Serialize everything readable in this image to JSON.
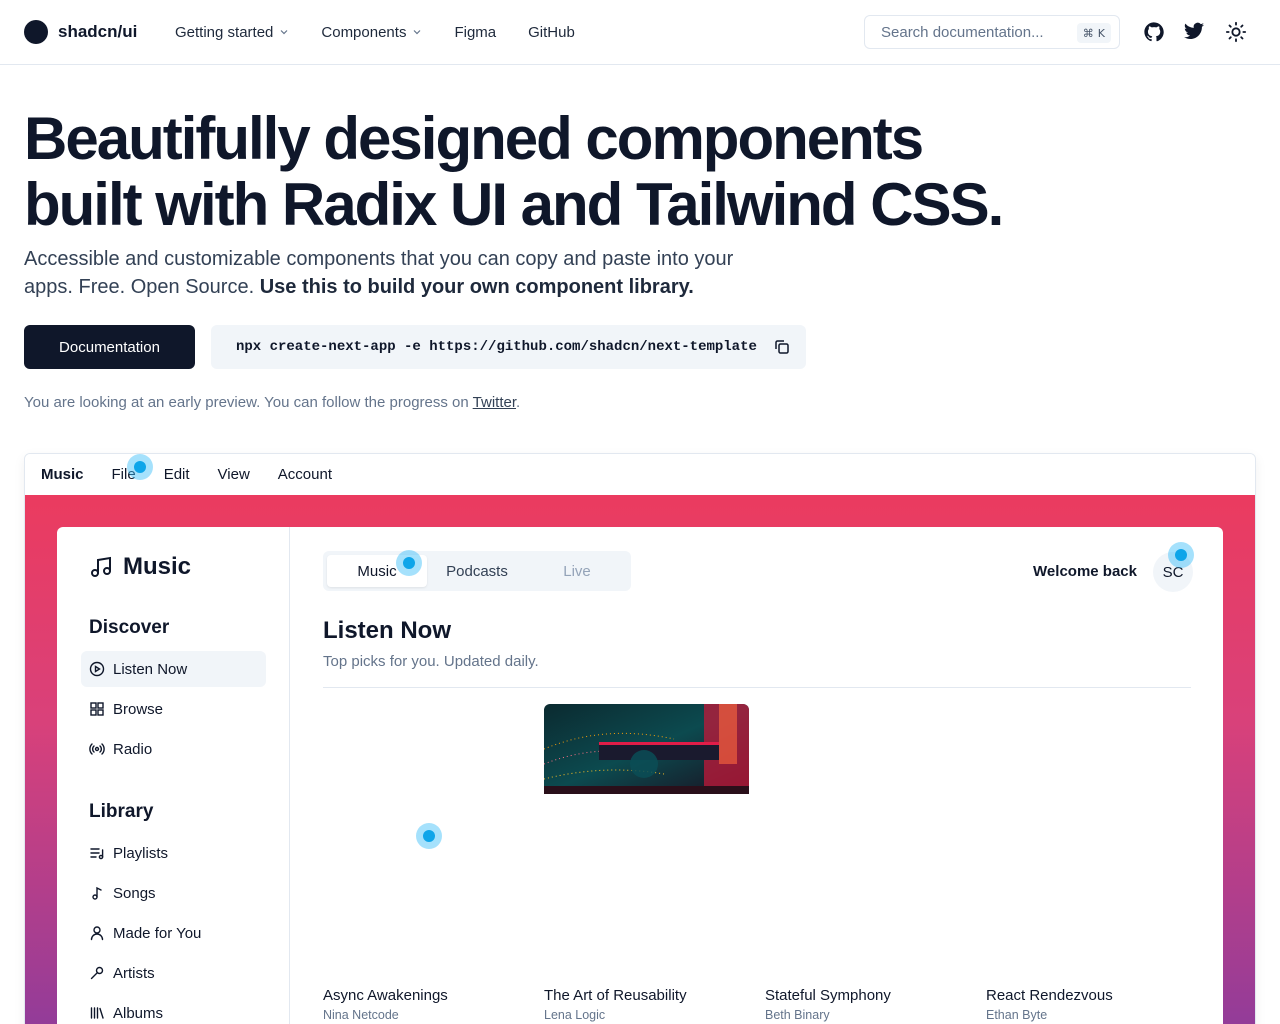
{
  "header": {
    "brand": "shadcn/ui",
    "nav": [
      {
        "label": "Getting started",
        "dropdown": true
      },
      {
        "label": "Components",
        "dropdown": true
      },
      {
        "label": "Figma",
        "dropdown": false
      },
      {
        "label": "GitHub",
        "dropdown": false
      }
    ],
    "search_placeholder": "Search documentation...",
    "search_shortcut_symbol": "⌘",
    "search_shortcut_key": "K",
    "icons": [
      "github-icon",
      "twitter-icon",
      "sun-icon"
    ]
  },
  "hero": {
    "title_line1": "Beautifully designed components",
    "title_line2": "built with Radix UI and Tailwind CSS.",
    "subtitle": "Accessible and customizable components that you can copy and paste into your apps. Free. Open Source.",
    "subtitle_bold": "Use this to build your own component library.",
    "doc_button": "Documentation",
    "command": "npx create-next-app -e https://github.com/shadcn/next-template",
    "note_prefix": "You are looking at an early preview. You can follow the progress on",
    "note_link": "Twitter",
    "note_suffix": "."
  },
  "demo": {
    "menubar": [
      "Music",
      "File",
      "Edit",
      "View",
      "Account"
    ],
    "app_title": "Music",
    "sections": {
      "discover": {
        "title": "Discover",
        "items": [
          {
            "label": "Listen Now",
            "icon": "play-circle-icon",
            "active": true
          },
          {
            "label": "Browse",
            "icon": "grid-icon",
            "active": false
          },
          {
            "label": "Radio",
            "icon": "radio-icon",
            "active": false
          }
        ]
      },
      "library": {
        "title": "Library",
        "items": [
          {
            "label": "Playlists",
            "icon": "playlist-icon"
          },
          {
            "label": "Songs",
            "icon": "music-note-icon"
          },
          {
            "label": "Made for You",
            "icon": "user-icon"
          },
          {
            "label": "Artists",
            "icon": "microphone-icon"
          },
          {
            "label": "Albums",
            "icon": "library-icon"
          }
        ]
      }
    },
    "tabs": [
      {
        "label": "Music",
        "state": "active"
      },
      {
        "label": "Podcasts",
        "state": "normal"
      },
      {
        "label": "Live",
        "state": "disabled"
      }
    ],
    "welcome": "Welcome back",
    "avatar": "SC",
    "listen_now_title": "Listen Now",
    "listen_now_sub": "Top picks for you. Updated daily.",
    "albums": [
      {
        "name": "Async Awakenings",
        "artist": "Nina Netcode"
      },
      {
        "name": "The Art of Reusability",
        "artist": "Lena Logic"
      },
      {
        "name": "Stateful Symphony",
        "artist": "Beth Binary"
      },
      {
        "name": "React Rendezvous",
        "artist": "Ethan Byte"
      }
    ]
  },
  "colors": {
    "primary": "#0f172a",
    "muted": "#64748b",
    "gradient_top": "#eb3b5f",
    "gradient_bottom": "#8b3b9c",
    "click_marker": "#0ea5e9"
  }
}
